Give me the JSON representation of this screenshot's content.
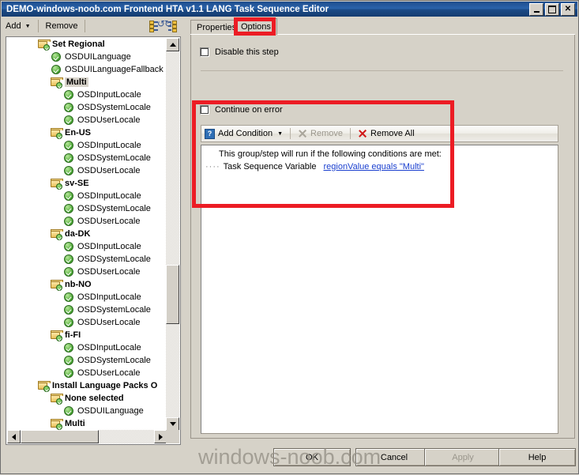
{
  "window": {
    "title": "DEMO-windows-noob.com Frontend HTA v1.1 LANG Task Sequence Editor",
    "minimize_label": "_",
    "maximize_label": "",
    "close_label": "✕"
  },
  "toolbar": {
    "add_label": "Add",
    "add_caret": "▼",
    "remove_label": "Remove",
    "icon_move_up": "move-up-icon",
    "icon_move_down": "move-down-icon"
  },
  "tree": {
    "items": [
      {
        "label": "Set Regional",
        "indent": 1,
        "type": "folder",
        "selected": false
      },
      {
        "label": "OSDUILanguage",
        "indent": 2,
        "type": "check",
        "selected": false
      },
      {
        "label": "OSDUILanguageFallback",
        "indent": 2,
        "type": "check",
        "selected": false
      },
      {
        "label": "Multi",
        "indent": 2,
        "type": "folder",
        "selected": true
      },
      {
        "label": "OSDInputLocale",
        "indent": 3,
        "type": "check",
        "selected": false
      },
      {
        "label": "OSDSystemLocale",
        "indent": 3,
        "type": "check",
        "selected": false
      },
      {
        "label": "OSDUserLocale",
        "indent": 3,
        "type": "check",
        "selected": false
      },
      {
        "label": "En-US",
        "indent": 2,
        "type": "folder",
        "selected": false
      },
      {
        "label": "OSDInputLocale",
        "indent": 3,
        "type": "check",
        "selected": false
      },
      {
        "label": "OSDSystemLocale",
        "indent": 3,
        "type": "check",
        "selected": false
      },
      {
        "label": "OSDUserLocale",
        "indent": 3,
        "type": "check",
        "selected": false
      },
      {
        "label": "sv-SE",
        "indent": 2,
        "type": "folder",
        "selected": false
      },
      {
        "label": "OSDInputLocale",
        "indent": 3,
        "type": "check",
        "selected": false
      },
      {
        "label": "OSDSystemLocale",
        "indent": 3,
        "type": "check",
        "selected": false
      },
      {
        "label": "OSDUserLocale",
        "indent": 3,
        "type": "check",
        "selected": false
      },
      {
        "label": "da-DK",
        "indent": 2,
        "type": "folder",
        "selected": false
      },
      {
        "label": "OSDInputLocale",
        "indent": 3,
        "type": "check",
        "selected": false
      },
      {
        "label": "OSDSystemLocale",
        "indent": 3,
        "type": "check",
        "selected": false
      },
      {
        "label": "OSDUserLocale",
        "indent": 3,
        "type": "check",
        "selected": false
      },
      {
        "label": "nb-NO",
        "indent": 2,
        "type": "folder",
        "selected": false
      },
      {
        "label": "OSDInputLocale",
        "indent": 3,
        "type": "check",
        "selected": false
      },
      {
        "label": "OSDSystemLocale",
        "indent": 3,
        "type": "check",
        "selected": false
      },
      {
        "label": "OSDUserLocale",
        "indent": 3,
        "type": "check",
        "selected": false
      },
      {
        "label": "fi-FI",
        "indent": 2,
        "type": "folder",
        "selected": false
      },
      {
        "label": "OSDInputLocale",
        "indent": 3,
        "type": "check",
        "selected": false
      },
      {
        "label": "OSDSystemLocale",
        "indent": 3,
        "type": "check",
        "selected": false
      },
      {
        "label": "OSDUserLocale",
        "indent": 3,
        "type": "check",
        "selected": false
      },
      {
        "label": "Install Language Packs O",
        "indent": 1,
        "type": "folder",
        "selected": false
      },
      {
        "label": "None selected",
        "indent": 2,
        "type": "folder",
        "selected": false
      },
      {
        "label": "OSDUILanguage",
        "indent": 3,
        "type": "check",
        "selected": false
      },
      {
        "label": "Multi",
        "indent": 2,
        "type": "folder",
        "selected": false
      }
    ],
    "vscroll": {
      "up_arrow": "scroll-up-arrow",
      "down_arrow": "scroll-down-arrow"
    },
    "hscroll": {
      "left_arrow": "scroll-left-arrow",
      "right_arrow": "scroll-right-arrow"
    }
  },
  "tabs": [
    {
      "label": "Properties",
      "active": false
    },
    {
      "label": "Options",
      "active": true
    }
  ],
  "options": {
    "disable_step_label": "Disable this step",
    "disable_step_checked": false,
    "continue_on_error_label": "Continue on error",
    "continue_on_error_checked": false
  },
  "condition_toolbar": {
    "add_condition_label": "Add Condition",
    "add_condition_caret": "▼",
    "add_condition_icon": "help-question-icon",
    "remove_label": "Remove",
    "remove_enabled": false,
    "remove_all_label": "Remove All",
    "remove_all_enabled": true
  },
  "conditions": {
    "header": "This group/step will run if the following conditions are met:",
    "tree_dots": "····",
    "row_prefix": "Task Sequence Variable",
    "row_link": "regionValue equals \"Multi\""
  },
  "buttons": {
    "ok": "OK",
    "cancel": "Cancel",
    "apply": "Apply",
    "apply_enabled": false,
    "help": "Help"
  },
  "watermark": "windows-noob.com",
  "colors": {
    "title_bar": "#1e4d8c",
    "face": "#d6d2c8",
    "annotation_red": "#ec1c24",
    "link_blue": "#1a3fcf",
    "check_green": "#49a533"
  }
}
